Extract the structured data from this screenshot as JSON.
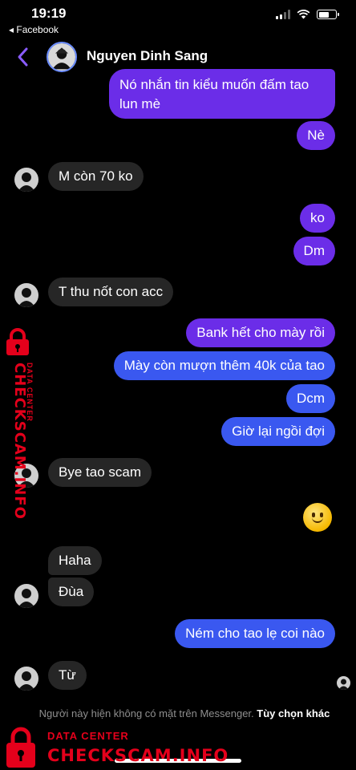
{
  "status_bar": {
    "time": "19:19",
    "back_app": "◂ Facebook",
    "battery_level": 0.6
  },
  "header": {
    "contact_name": "Nguyen Dinh Sang"
  },
  "messages": [
    {
      "from": "me",
      "text": "Nó nhắn tin kiểu muốn đấm tao",
      "text2": "lun mè"
    },
    {
      "from": "me",
      "text": "Nè"
    },
    {
      "from": "them",
      "text": "M còn 70 ko"
    },
    {
      "from": "me",
      "text": "ko"
    },
    {
      "from": "me",
      "text": "Dm"
    },
    {
      "from": "them",
      "text": "T thu nốt con acc"
    },
    {
      "from": "me",
      "text": "Bank hết cho mày rồi"
    },
    {
      "from": "me",
      "text": "Mày còn mượn thêm 40k của tao"
    },
    {
      "from": "me",
      "text": "Dcm"
    },
    {
      "from": "me",
      "text": "Giờ lại ngồi đợi"
    },
    {
      "from": "them",
      "text": "Bye tao scam"
    },
    {
      "from": "me",
      "emoji": "slightly-smiling-face"
    },
    {
      "from": "them",
      "text": "Haha"
    },
    {
      "from": "them",
      "text": "Đùa"
    },
    {
      "from": "me",
      "text": "Ném cho tao lẹ coi nào"
    },
    {
      "from": "them",
      "text": "Từ"
    }
  ],
  "footer": {
    "note": "Người này hiện không có mặt trên Messenger.",
    "action": "Tùy chọn khác"
  },
  "watermark": {
    "small": "DATA CENTER",
    "big": "CHECKSCAM.INFO"
  },
  "colors": {
    "outgoing": "#6b2de8",
    "outgoing_late": "#3a58f0",
    "incoming": "#262626",
    "watermark": "#e4001b"
  }
}
